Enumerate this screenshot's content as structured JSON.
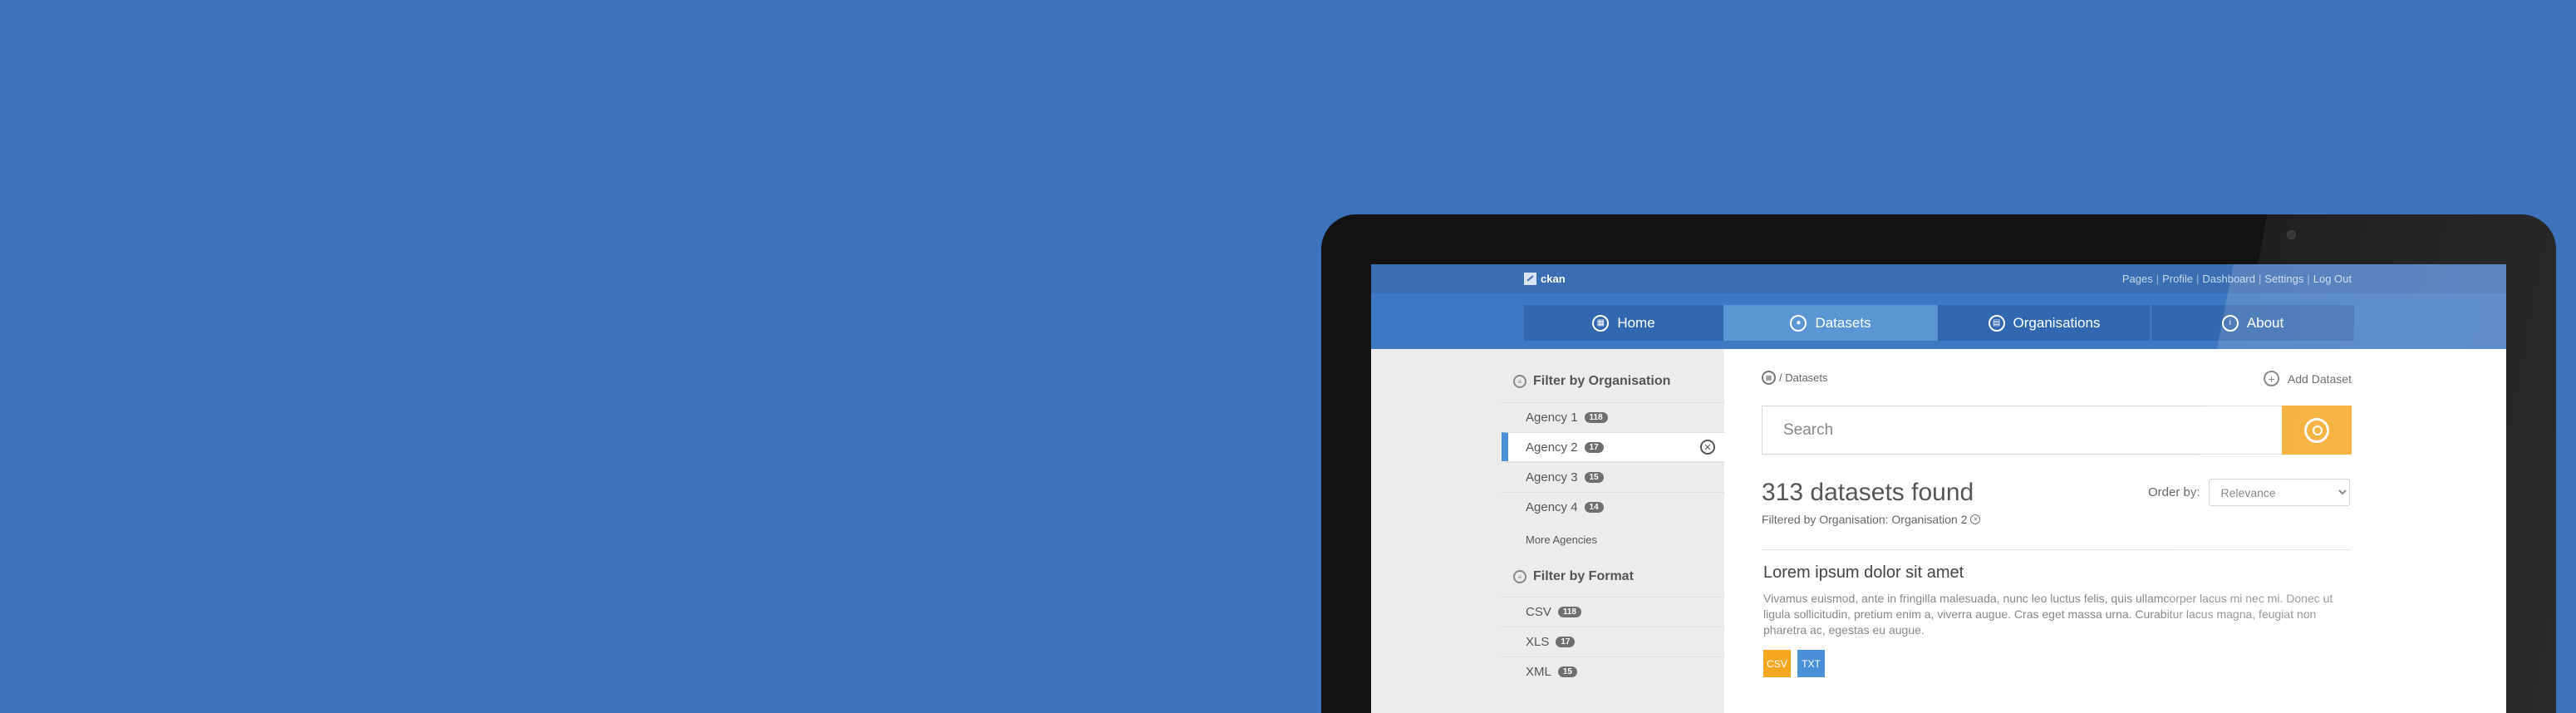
{
  "colors": {
    "background": "#3d73bc",
    "accent": "#f5a623",
    "nav_active": "#5a96d4",
    "csv_tag": "#f5a623",
    "txt_tag": "#4a90d9"
  },
  "app": {
    "logo_text": "ckan"
  },
  "top_links": [
    "Pages",
    "Profile",
    "Dashboard",
    "Settings",
    "Log Out"
  ],
  "nav": {
    "tabs": [
      {
        "label": "Home",
        "icon": "home-icon"
      },
      {
        "label": "Datasets",
        "icon": "datasets-icon",
        "active": true
      },
      {
        "label": "Organisations",
        "icon": "organisations-icon"
      },
      {
        "label": "About",
        "icon": "info-icon"
      }
    ]
  },
  "sidebar": {
    "org_heading": "Filter by Organisation",
    "orgs": [
      {
        "label": "Agency 1",
        "count": "118"
      },
      {
        "label": "Agency 2",
        "count": "17",
        "active": true
      },
      {
        "label": "Agency 3",
        "count": "15"
      },
      {
        "label": "Agency 4",
        "count": "14"
      }
    ],
    "more_label": "More Agencies",
    "format_heading": "Filter by Format",
    "formats": [
      {
        "label": "CSV",
        "count": "118"
      },
      {
        "label": "XLS",
        "count": "17"
      },
      {
        "label": "XML",
        "count": "15"
      }
    ]
  },
  "main": {
    "breadcrumb": "/ Datasets",
    "add_dataset": "Add Dataset",
    "search_placeholder": "Search",
    "results_count": "313 datasets found",
    "filtered_by": "Filtered by Organisation: Organisation 2",
    "order_label": "Order by:",
    "order_value": "Relevance",
    "dataset": {
      "title": "Lorem ipsum dolor sit amet",
      "description": "Vivamus euismod, ante in fringilla malesuada, nunc leo luctus felis, quis ullamcorper lacus mi nec mi. Donec ut ligula sollicitudin, pretium enim a, viverra augue. Cras eget massa urna. Curabitur lacus magna, feugiat non pharetra ac, egestas eu augue.",
      "tags": [
        "CSV",
        "TXT"
      ]
    }
  }
}
